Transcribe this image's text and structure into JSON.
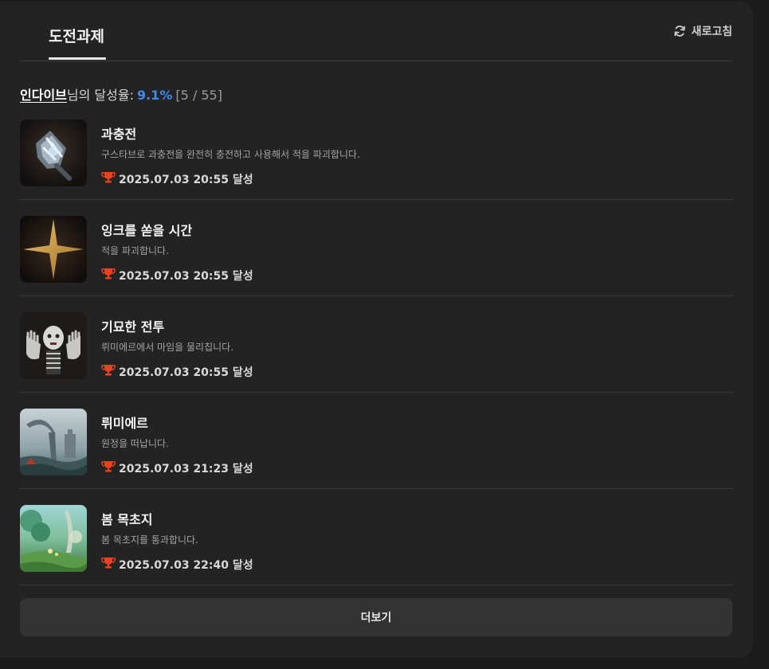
{
  "header": {
    "tab_label": "도전과제",
    "refresh_label": "새로고침"
  },
  "summary": {
    "user": "인다이브",
    "suffix": "님의 달성율:",
    "rate": "9.1%",
    "count": "[5 / 55]"
  },
  "achievements": [
    {
      "title": "과충전",
      "description": "구스타브로 과충전을 완전히 충전하고 사용해서 적을 파괴합니다.",
      "achieved": "2025.07.03 20:55 달성",
      "icon": "glove-gauntlet-icon"
    },
    {
      "title": "잉크를 쏟을 시간",
      "description": "적을 파괴합니다.",
      "achieved": "2025.07.03 20:55 달성",
      "icon": "gold-star-icon"
    },
    {
      "title": "기묘한 전투",
      "description": "뤼미에르에서 마임을 물리칩니다.",
      "achieved": "2025.07.03 20:55 달성",
      "icon": "mime-icon"
    },
    {
      "title": "뤼미에르",
      "description": "원정을 떠납니다.",
      "achieved": "2025.07.03 21:23 달성",
      "icon": "lumiere-city-icon"
    },
    {
      "title": "봄 목초지",
      "description": "봄 목초지를 통과합니다.",
      "achieved": "2025.07.03 22:40 달성",
      "icon": "spring-meadow-icon"
    }
  ],
  "more_label": "더보기",
  "colors": {
    "accent": "#3b8cf0",
    "trophy": "#e8421f",
    "panel": "#232323",
    "background": "#1b1b1b"
  }
}
